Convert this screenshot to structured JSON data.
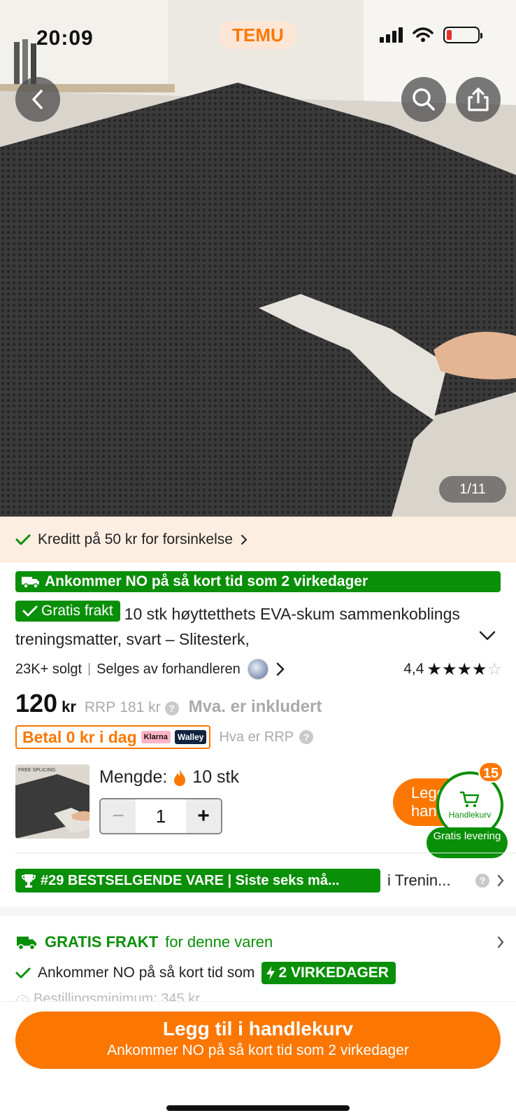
{
  "status_bar": {
    "time": "20:09",
    "app_badge": "TEMU",
    "overlay_text": "FREE SPLICING"
  },
  "hero": {
    "page_counter": "1/11"
  },
  "credit_banner": {
    "text": "Kreditt på 50 kr for forsinkelse"
  },
  "arrival_banner": {
    "text": "Ankommer NO på så kort tid som 2 virkedager"
  },
  "product": {
    "free_shipping_tag": "Gratis frakt",
    "title": "10 stk høyttetthets EVA-skum sammenkoblings treningsmatter, svart – Slitesterk,",
    "sold": "23K+ solgt",
    "seller": "Selges av forhandleren",
    "rating": "4,4",
    "rating_value": 4.4,
    "price": "120",
    "currency": "kr",
    "rrp_label": "RRP",
    "rrp_value": "181 kr",
    "vat_note": "Mva. er inkludert",
    "pay_today": "Betal 0 kr i dag",
    "klarna": "Klarna",
    "walley": "Walley",
    "rrp_help": "Hva er RRP"
  },
  "quantity": {
    "label": "Mengde:",
    "pack": "10 stk",
    "value": "1",
    "thumb_text": "FREE SPLICING"
  },
  "floating_cart": {
    "add_partial": "Legg handl",
    "cart_label": "Handlekurv",
    "count": "15",
    "free_delivery": "Gratis levering"
  },
  "bestseller": {
    "badge": "#29 BESTSELGENDE VARE | Siste seks må...",
    "category": "i Trenin..."
  },
  "shipping": {
    "title": "GRATIS FRAKT",
    "subtitle": "for denne varen",
    "arrival": "Ankommer NO på så kort tid som",
    "days_badge": "2 VIRKEDAGER",
    "minimum": "Bestillingsminimum: 345 kr"
  },
  "cta": {
    "main": "Legg til i handlekurv",
    "sub": "Ankommer NO på så kort tid som 2 virkedager"
  },
  "colors": {
    "accent": "#fb7701",
    "green": "#0a8f08",
    "credit_bg": "#fdeee2"
  }
}
